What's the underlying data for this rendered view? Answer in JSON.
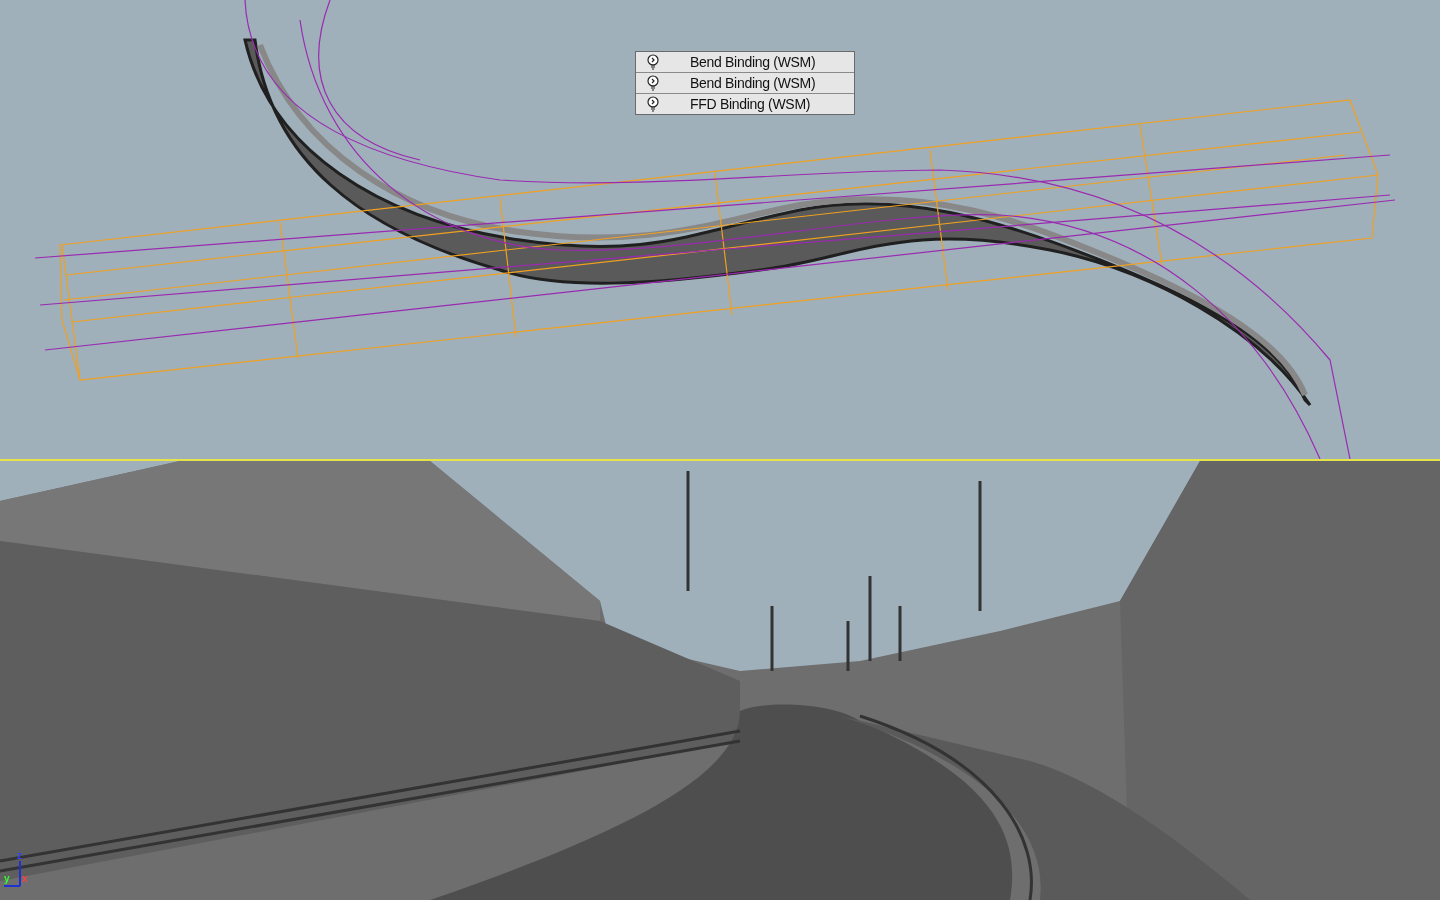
{
  "top_viewport": {
    "modifier_stack": [
      {
        "label": "Bend Binding (WSM)",
        "on": true
      },
      {
        "label": "Bend Binding (WSM)",
        "on": true
      },
      {
        "label": "FFD Binding (WSM)",
        "on": true
      }
    ]
  },
  "bottom_viewport": {
    "axis_labels": [
      "z",
      "y",
      "x"
    ]
  }
}
